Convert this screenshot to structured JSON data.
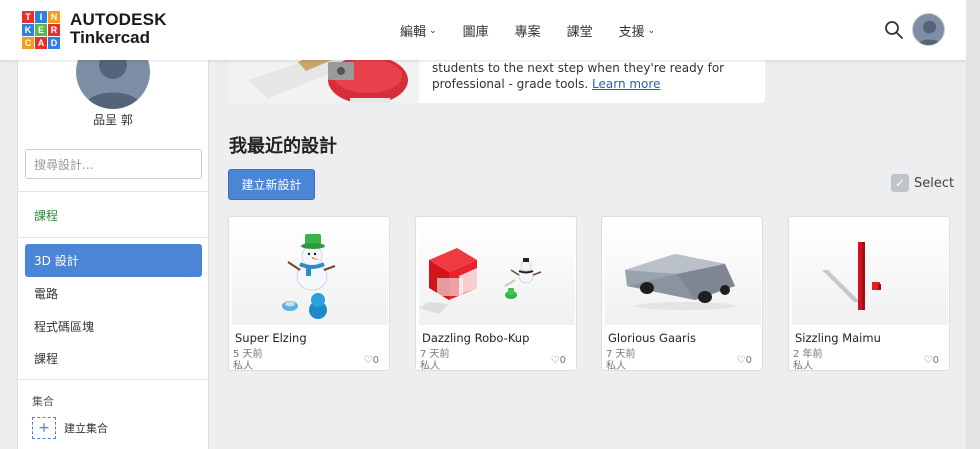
{
  "brand": {
    "logo_letters": [
      "T",
      "I",
      "N",
      "K",
      "E",
      "R",
      "C",
      "A",
      "D"
    ],
    "logo_colors": [
      "#e8312f",
      "#2f7fe0",
      "#f39b1a",
      "#2f7fe0",
      "#58b947",
      "#e8312f",
      "#f39b1a",
      "#e8312f",
      "#2f7fe0"
    ],
    "line1": "AUTODESK",
    "line2": "Tinkercad"
  },
  "nav": {
    "items": [
      {
        "label": "編輯",
        "dropdown": true
      },
      {
        "label": "圖庫",
        "dropdown": false
      },
      {
        "label": "專案",
        "dropdown": false
      },
      {
        "label": "課堂",
        "dropdown": false
      },
      {
        "label": "支援",
        "dropdown": true
      }
    ]
  },
  "sidebar": {
    "profile_name": "品呈 郭",
    "search_placeholder": "搜尋設計...",
    "classes_link": "課程",
    "items": [
      {
        "label": "3D 設計",
        "active": true
      },
      {
        "label": "電路",
        "active": false
      },
      {
        "label": "程式碼區塊",
        "active": false
      },
      {
        "label": "課程",
        "active": false
      }
    ],
    "collections_heading": "集合",
    "create_collection": "建立集合"
  },
  "banner": {
    "text": "students to the next step when they're ready for professional - grade tools.",
    "link": "Learn more"
  },
  "main": {
    "title": "我最近的設計",
    "create_button": "建立新設計",
    "select_label": "Select"
  },
  "designs": [
    {
      "name": "Super Elzing",
      "age": "5 天前",
      "visibility": "私人",
      "likes": "0"
    },
    {
      "name": "Dazzling Robo-Kup",
      "age": "7 天前",
      "visibility": "私人",
      "likes": "0"
    },
    {
      "name": "Glorious Gaaris",
      "age": "7 天前",
      "visibility": "私人",
      "likes": "0"
    },
    {
      "name": "Sizzling Maimu",
      "age": "2 年前",
      "visibility": "私人",
      "likes": "0"
    }
  ],
  "colors": {
    "accent": "#4a85d6",
    "green_link": "#2a8a3a"
  }
}
